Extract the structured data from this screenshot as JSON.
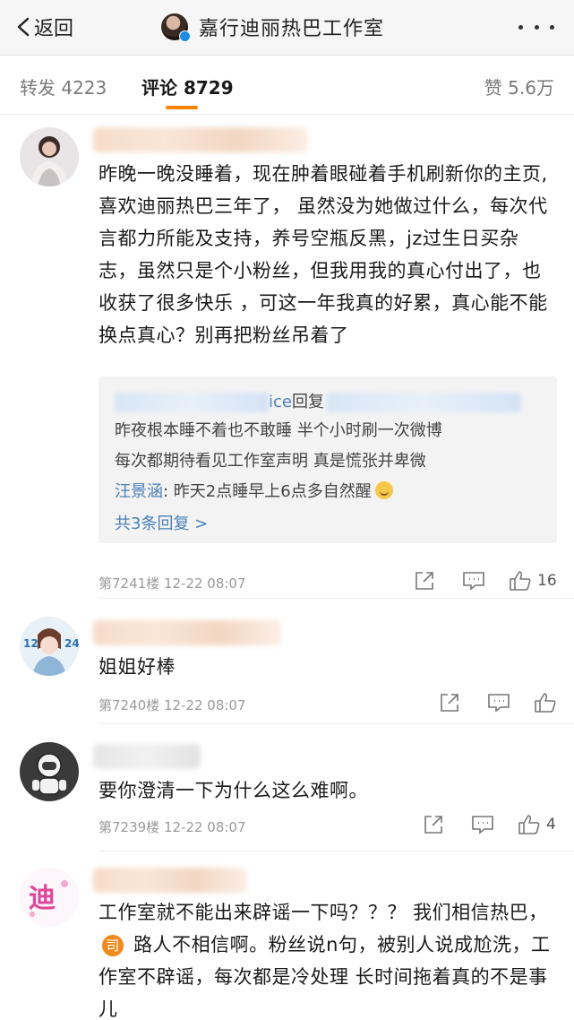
{
  "header": {
    "back_label": "返回",
    "title": "嘉行迪丽热巴工作室"
  },
  "tabs": {
    "repost": "转发 4223",
    "comments": "评论 8729",
    "likes": "赞 5.6万",
    "accent_color": "#ff8200"
  },
  "comments": [
    {
      "text": "昨晚一晚没睡着，现在肿着眼碰着手机刷新你的主页,喜欢迪丽热巴三年了， 虽然没为她做过什么，每次代言都力所能及支持，养号空瓶反黑，jz过生日买杂志，虽然只是个小粉丝，但我用我的真心付出了，也收获了很多快乐 ，可这一年我真的好累，真心能不能换点真心？别再把粉丝吊着了",
      "reply": {
        "line1_name_suffix": "ice",
        "line1_action": "回复",
        "line2": "昨夜根本睡不着也不敢睡  半个小时刷一次微博",
        "line3": "每次都期待看见工作室声明   真是慌张并卑微",
        "line4_name": "汪景涵",
        "line4_text": ": 昨天2点睡早上6点多自然醒",
        "more": "共3条回复 >"
      },
      "meta": "第7241楼 12-22 08:07",
      "likes": "16"
    },
    {
      "text": "姐姐好棒",
      "meta": "第7240楼 12-22 08:07",
      "likes": ""
    },
    {
      "text": "要你澄清一下为什么这么难啊。",
      "meta": "第7239楼 12-22 08:07",
      "likes": "4"
    },
    {
      "text_part1": "工作室就不能出来辟谣一下吗？？？ 我们相信热巴，",
      "badge": "司",
      "text_part2": " 路人不相信啊。粉丝说n句，被别人说成尬洗，工作室不辟谣，每次都是冷处理 长时间拖着真的不是事儿"
    }
  ]
}
